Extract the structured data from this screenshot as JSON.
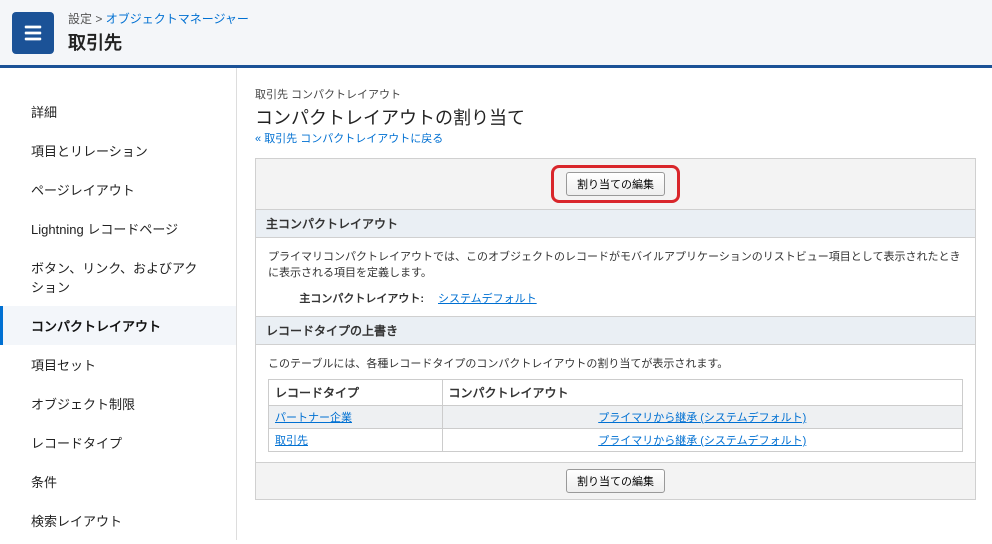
{
  "header": {
    "breadcrumb_setup": "設定",
    "breadcrumb_sep": " > ",
    "breadcrumb_objmgr": "オブジェクトマネージャー",
    "title": "取引先"
  },
  "sidebar": {
    "items": [
      {
        "label": "詳細"
      },
      {
        "label": "項目とリレーション"
      },
      {
        "label": "ページレイアウト"
      },
      {
        "label": "Lightning レコードページ"
      },
      {
        "label": "ボタン、リンク、およびアクション"
      },
      {
        "label": "コンパクトレイアウト"
      },
      {
        "label": "項目セット"
      },
      {
        "label": "オブジェクト制限"
      },
      {
        "label": "レコードタイプ"
      },
      {
        "label": "条件"
      },
      {
        "label": "検索レイアウト"
      }
    ],
    "active_index": 5
  },
  "main": {
    "crumb": "取引先 コンパクトレイアウト",
    "title": "コンパクトレイアウトの割り当て",
    "back_prefix": "« ",
    "back_text": "取引先 コンパクトレイアウトに戻る",
    "edit_button": "割り当ての編集",
    "section_primary": "主コンパクトレイアウト",
    "primary_desc": "プライマリコンパクトレイアウトでは、このオブジェクトのレコードがモバイルアプリケーションのリストビュー項目として表示されたときに表示される項目を定義します。",
    "primary_label": "主コンパクトレイアウト:",
    "primary_value": "システムデフォルト",
    "section_override": "レコードタイプの上書き",
    "override_desc": "このテーブルには、各種レコードタイプのコンパクトレイアウトの割り当てが表示されます。",
    "col_record_type": "レコードタイプ",
    "col_compact": "コンパクトレイアウト",
    "rows": [
      {
        "rt": "パートナー企業",
        "cl": "プライマリから継承 (システムデフォルト)"
      },
      {
        "rt": "取引先",
        "cl": "プライマリから継承 (システムデフォルト)"
      }
    ]
  }
}
